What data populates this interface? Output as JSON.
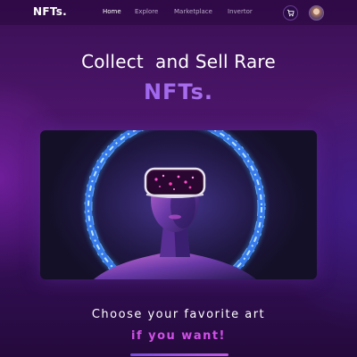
{
  "header": {
    "logo": "NFTs.",
    "nav": [
      "Home",
      "Explore",
      "Marketplace",
      "Invertor"
    ],
    "active_nav": "Home",
    "cart_icon": "cart-icon",
    "avatar_icon": "user-avatar"
  },
  "hero": {
    "headline": "Collect  and Sell Rare",
    "accent": "NFTs.",
    "image": "vr-headset-figure-neon-ring"
  },
  "tagline": {
    "line1": "Choose your favorite art",
    "line2": "if you want!"
  },
  "colors": {
    "accent_purple": "#a46bf0",
    "accent_pink": "#d04fe6",
    "background": "#3a0f55"
  }
}
